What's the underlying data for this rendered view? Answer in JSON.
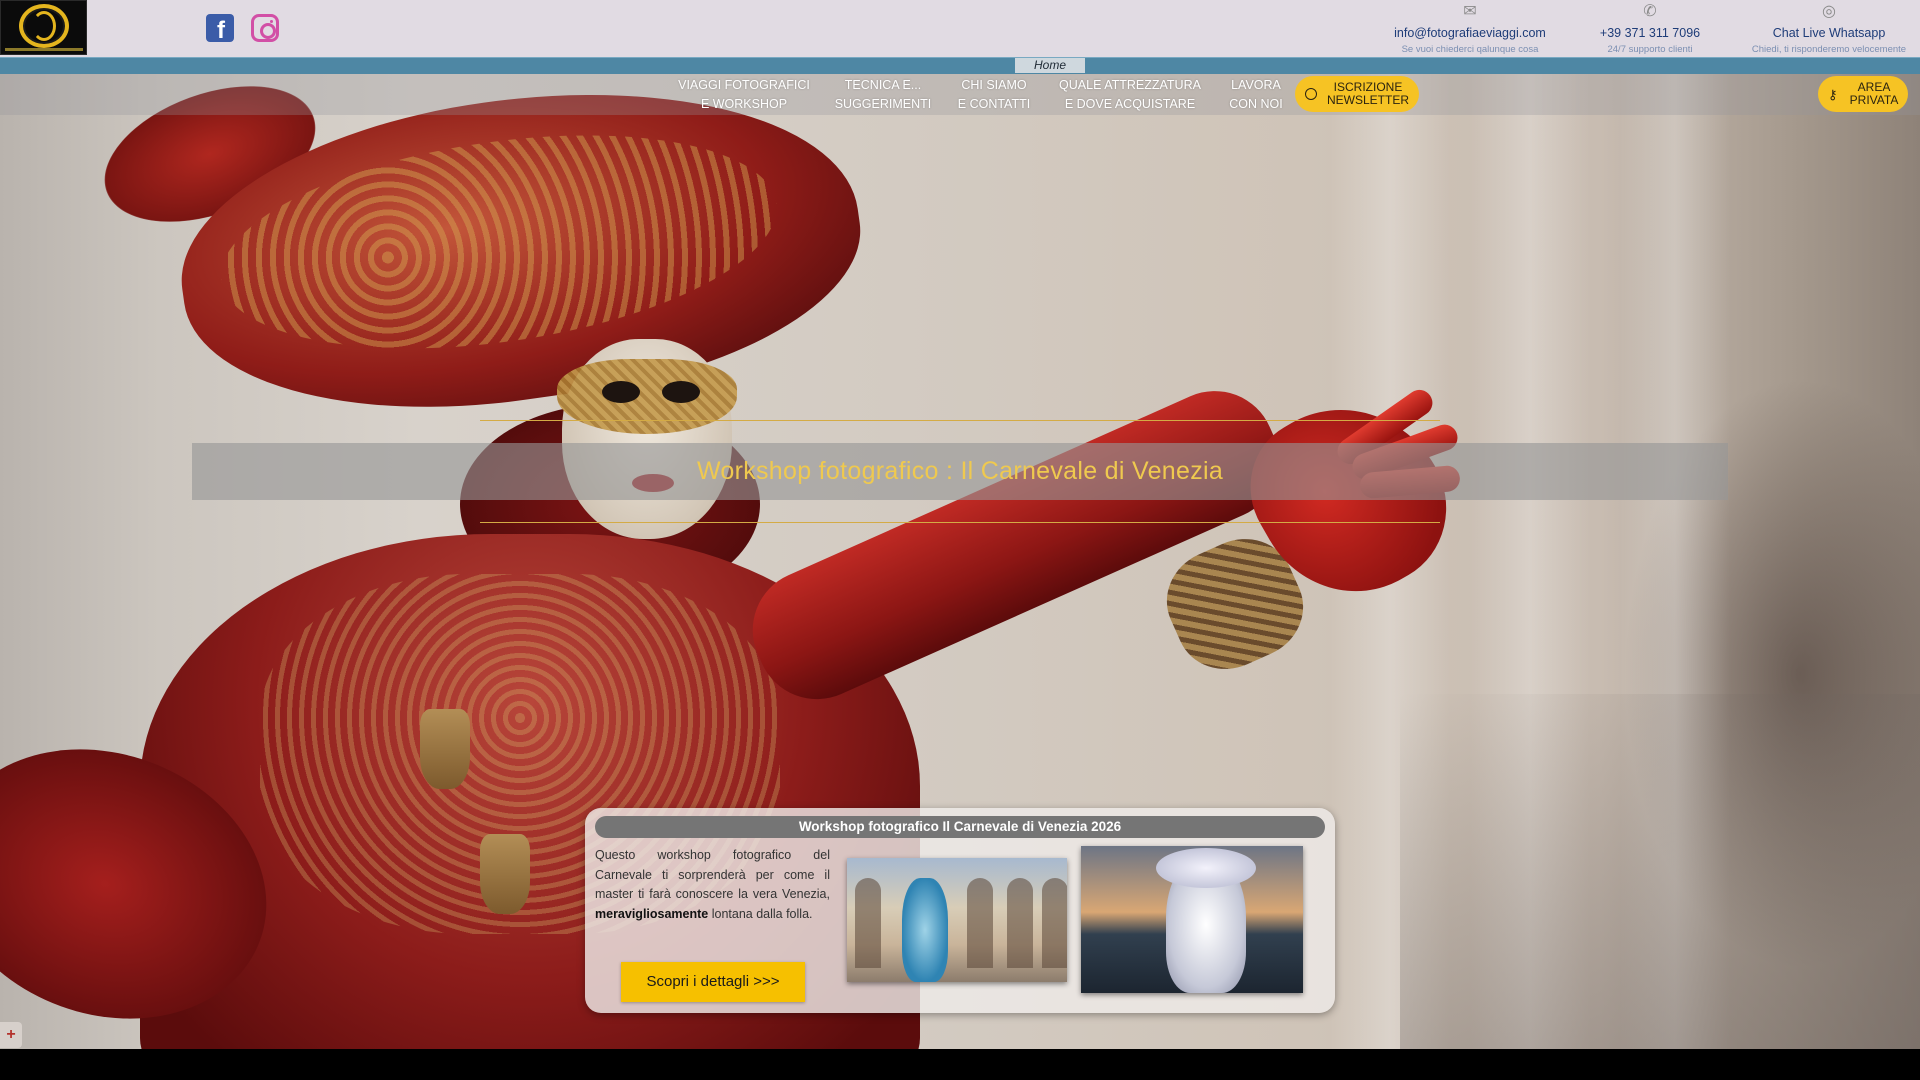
{
  "header": {
    "logo_alt": "Fotografia e Viaggi",
    "social": [
      {
        "name": "facebook",
        "icon": "facebook-icon",
        "color": "#3b5ca8"
      },
      {
        "name": "instagram",
        "icon": "instagram-icon",
        "color": "#d24fa6"
      }
    ],
    "contacts": {
      "email": {
        "icon": "mail-icon",
        "label": "info@fotografiaeviaggi.com",
        "sub": "Se vuoi chiederci qalunque cosa"
      },
      "phone": {
        "icon": "phone-icon",
        "label": "+39 371 311 7096",
        "sub": "24/7 supporto clienti"
      },
      "whatsapp": {
        "icon": "whatsapp-icon",
        "label": "Chat Live Whatsapp",
        "sub": "Chiedi, ti risponderemo velocemente"
      }
    },
    "breadcrumb": "Home"
  },
  "nav": {
    "items": [
      {
        "line1": "VIAGGI FOTOGRAFICI",
        "line2": "E WORKSHOP"
      },
      {
        "line1": "TECNICA E...",
        "line2": "SUGGERIMENTI"
      },
      {
        "line1": "CHI SIAMO",
        "line2": "E CONTATTI"
      },
      {
        "line1": "QUALE ATTREZZATURA",
        "line2": "E DOVE ACQUISTARE"
      },
      {
        "line1": "LAVORA",
        "line2": "CON NOI"
      }
    ],
    "newsletter": {
      "icon": "smiley-icon",
      "line1": "ISCRIZIONE",
      "line2": "NEWSLETTER"
    },
    "private_area": {
      "icon": "key-icon",
      "line1": "AREA",
      "line2": "PRIVATA"
    }
  },
  "hero": {
    "title": "Workshop fotografico : Il Carnevale di Venezia"
  },
  "card": {
    "title": "Workshop fotografico Il Carnevale di Venezia 2026",
    "text_before": "Questo workshop fotografico del Carnevale ti sorprenderà per come il master ti farà conoscere la vera Venezia, ",
    "text_bold": "meravigliosamente",
    "text_after": " lontana dalla folla.",
    "cta": "Scopri i dettagli >>>"
  },
  "colors": {
    "accent_yellow": "#f6c324",
    "title_gold": "#efc94f",
    "top_bar": "#e1dbe3",
    "blue_bar": "#4e87a4",
    "link_blue": "#1e3c78"
  }
}
